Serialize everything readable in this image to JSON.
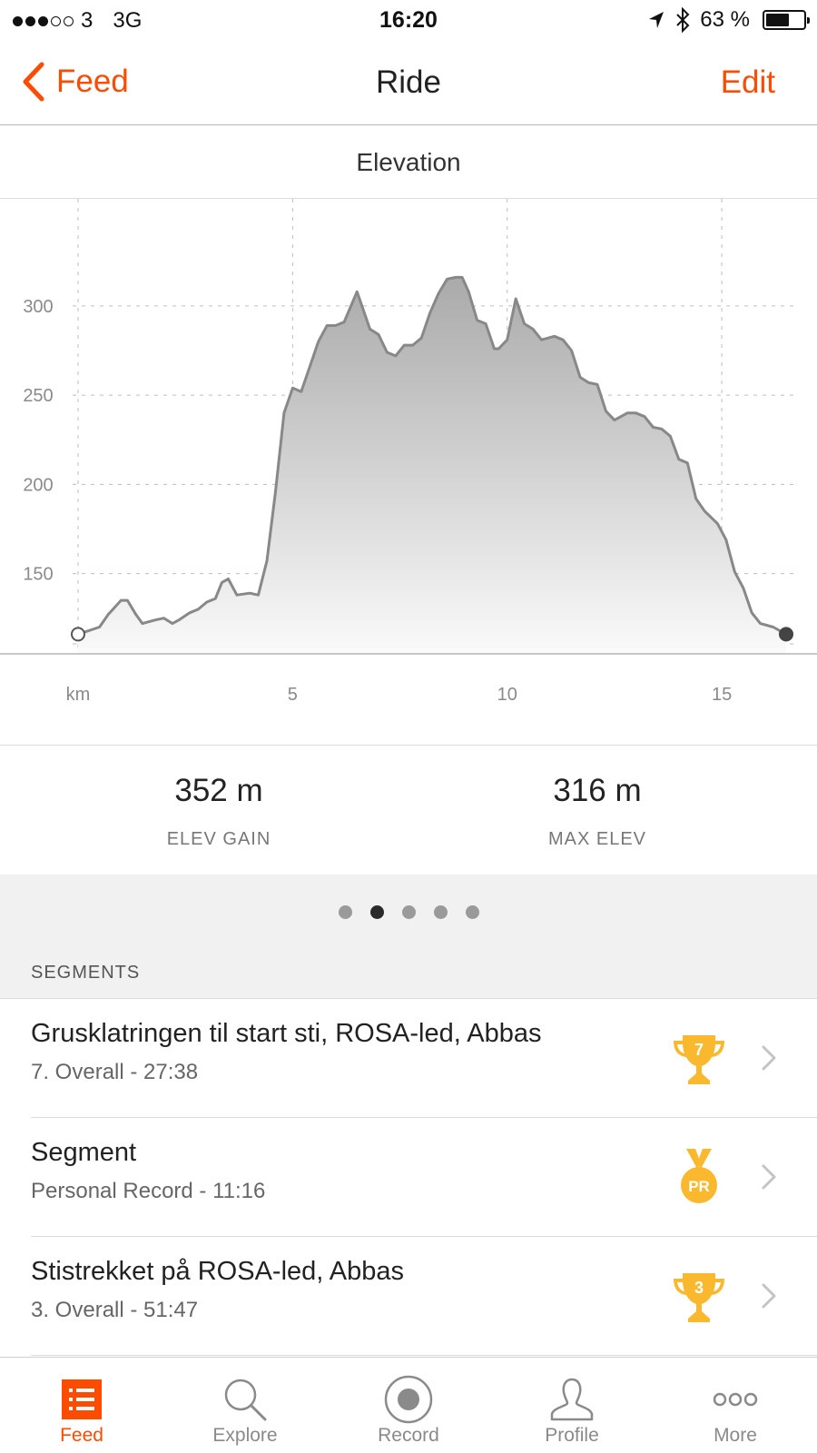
{
  "status_bar": {
    "carrier": "3",
    "network": "3G",
    "time": "16:20",
    "battery": "63 %",
    "battery_level": 0.63
  },
  "nav": {
    "back_label": "Feed",
    "title": "Ride",
    "edit_label": "Edit"
  },
  "chart_title": "Elevation",
  "chart_data": {
    "type": "area",
    "xlabel": "km",
    "x_ticks": [
      "5",
      "10",
      "15"
    ],
    "x_tick_values": [
      5,
      10,
      15
    ],
    "y_ticks": [
      "150",
      "200",
      "250",
      "300"
    ],
    "y_tick_values": [
      150,
      200,
      250,
      300
    ],
    "xlim": [
      0,
      16.5
    ],
    "ylim": [
      105,
      360
    ],
    "grid": true,
    "x": [
      0,
      0.5,
      0.7,
      1.0,
      1.15,
      1.35,
      1.5,
      1.8,
      2.0,
      2.2,
      2.35,
      2.6,
      2.8,
      3.0,
      3.2,
      3.35,
      3.5,
      3.7,
      4.0,
      4.2,
      4.4,
      4.6,
      4.8,
      5.0,
      5.2,
      5.4,
      5.6,
      5.8,
      6.0,
      6.2,
      6.5,
      6.8,
      7.0,
      7.2,
      7.4,
      7.6,
      7.8,
      8.0,
      8.2,
      8.4,
      8.6,
      8.8,
      8.95,
      9.1,
      9.3,
      9.5,
      9.7,
      9.8,
      10.0,
      10.2,
      10.4,
      10.6,
      10.8,
      11.1,
      11.3,
      11.5,
      11.7,
      11.9,
      12.1,
      12.3,
      12.5,
      12.8,
      13.0,
      13.2,
      13.4,
      13.6,
      13.8,
      14.0,
      14.2,
      14.4,
      14.6,
      14.9,
      15.1,
      15.3,
      15.5,
      15.7,
      15.9,
      16.2,
      16.5
    ],
    "y": [
      116,
      120,
      127,
      135,
      135,
      127,
      122,
      124,
      125,
      122,
      124,
      128,
      130,
      134,
      136,
      145,
      147,
      138,
      139,
      138,
      157,
      196,
      240,
      254,
      252,
      266,
      280,
      289,
      289,
      291,
      308,
      287,
      284,
      274,
      272,
      278,
      278,
      282,
      296,
      307,
      315,
      316,
      316,
      308,
      292,
      290,
      276,
      276,
      281,
      304,
      290,
      287,
      281,
      283,
      281,
      275,
      260,
      257,
      256,
      241,
      236,
      240,
      240,
      238,
      232,
      231,
      227,
      214,
      212,
      192,
      185,
      178,
      169,
      151,
      142,
      128,
      122,
      120,
      116
    ]
  },
  "stats": [
    {
      "value": "352 m",
      "label": "ELEV GAIN"
    },
    {
      "value": "316 m",
      "label": "MAX ELEV"
    }
  ],
  "pager": {
    "count": 5,
    "active_index": 1
  },
  "segments_title": "SEGMENTS",
  "segments": [
    {
      "name": "Grusklatringen til start sti, ROSA-led, Abbas",
      "detail": "7. Overall - 27:38",
      "award_type": "trophy",
      "award_label": "7"
    },
    {
      "name": "Segment",
      "detail": "Personal Record - 11:16",
      "award_type": "medal",
      "award_label": "PR"
    },
    {
      "name": "Stistrekket på ROSA-led, Abbas",
      "detail": "3. Overall - 51:47",
      "award_type": "trophy",
      "award_label": "3"
    }
  ],
  "tabs": [
    {
      "label": "Feed",
      "icon": "feed-icon",
      "active": true
    },
    {
      "label": "Explore",
      "icon": "search-icon",
      "active": false
    },
    {
      "label": "Record",
      "icon": "record-icon",
      "active": false
    },
    {
      "label": "Profile",
      "icon": "profile-icon",
      "active": false
    },
    {
      "label": "More",
      "icon": "more-icon",
      "active": false
    }
  ],
  "colors": {
    "accent": "#fc4c02",
    "award_gold": "#f9b82e",
    "chart_line": "#888888"
  }
}
